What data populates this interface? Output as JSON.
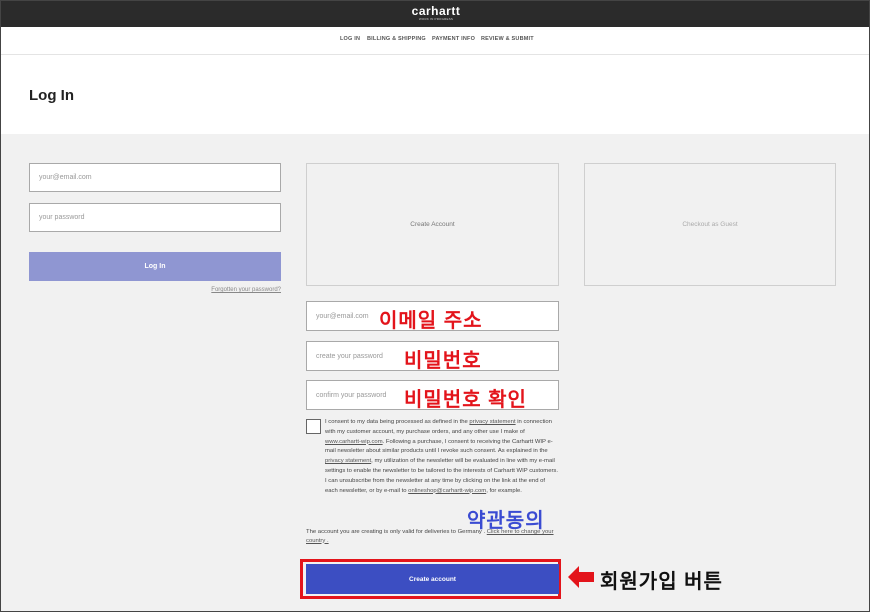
{
  "brand": {
    "logo": "carhartt",
    "tagline": "WORK IN PROGRESS"
  },
  "steps": [
    "LOG IN",
    "BILLING & SHIPPING",
    "PAYMENT INFO",
    "REVIEW & SUBMIT"
  ],
  "page_title": "Log In",
  "login": {
    "email_placeholder": "your@email.com",
    "password_placeholder": "your password",
    "login_button": "Log In",
    "forgot_link": "Forgotten your password?"
  },
  "panels": {
    "create_account": "Create Account",
    "checkout_guest": "Checkout as Guest"
  },
  "register": {
    "email_placeholder": "your@email.com",
    "password_placeholder": "create your password",
    "confirm_placeholder": "confirm your password",
    "create_button": "Create account"
  },
  "consent": {
    "p1": "I consent to my data being processed as defined in the ",
    "link1": "privacy statement",
    "p2": " in connection with my customer account, my purchase orders, and any other use I make of ",
    "link2": "www.carhartt-wip.com",
    "p3": ". Following a purchase, I consent to receiving the Carhartt WIP e-mail newsletter about similar products until I revoke such consent. As explained in the ",
    "link3": "privacy statement",
    "p4": ", my utilization of the newsletter will be evaluated in line with my e-mail settings to enable the newsletter to be tailored to the interests of Carhartt WIP customers. I can unsubscribe from the newsletter at any time by clicking on the link at the end of each newsletter, or by e-mail to ",
    "link4": "onlineshop@carhartt-wip.com",
    "p5": ", for example."
  },
  "delivery": {
    "text": "The account you are creating is only valid for deliveries to Germany . ",
    "link": "Click here to change your country ."
  },
  "annotations": {
    "email": "이메일 주소",
    "password": "비밀번호",
    "password_confirm": "비밀번호 확인",
    "terms": "약관동의",
    "signup_button": "회원가입 버튼"
  },
  "colors": {
    "accent": "#3c4ec2",
    "login_button": "#8f96d2",
    "annotation": "#e3141b",
    "annotation_blue": "#3a4bd2"
  }
}
